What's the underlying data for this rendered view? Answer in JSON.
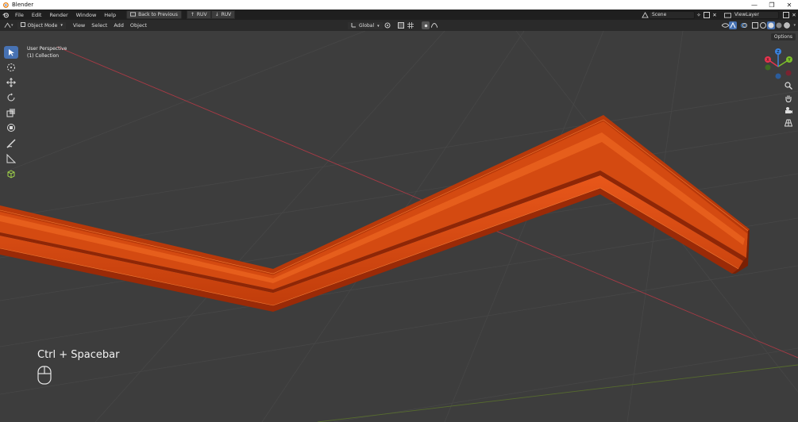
{
  "window": {
    "title": "Blender"
  },
  "menu": {
    "items": [
      "File",
      "Edit",
      "Render",
      "Window",
      "Help"
    ]
  },
  "toolbar": {
    "back_to_previous": "Back to Previous",
    "ruv_up": "RUV",
    "ruv_down": "RUV"
  },
  "scene": {
    "name": "Scene"
  },
  "view_layer": {
    "name": "ViewLayer"
  },
  "header3d": {
    "mode": "Object Mode",
    "menus": [
      "View",
      "Select",
      "Add",
      "Object"
    ],
    "orientation": "Global"
  },
  "viewport": {
    "view_name": "User Perspective",
    "collection": "(1) Collection",
    "options_label": "Options",
    "keycast": "Ctrl + Spacebar"
  },
  "gizmo": {
    "x": "X",
    "y": "Y",
    "z": "Z"
  },
  "colors": {
    "model": "#d9470f",
    "x_axis": "#e8344e",
    "y_axis": "#7cbf2a",
    "z_axis": "#3b84e0",
    "accent": "#4772b3",
    "background": "#3d3d3d"
  }
}
